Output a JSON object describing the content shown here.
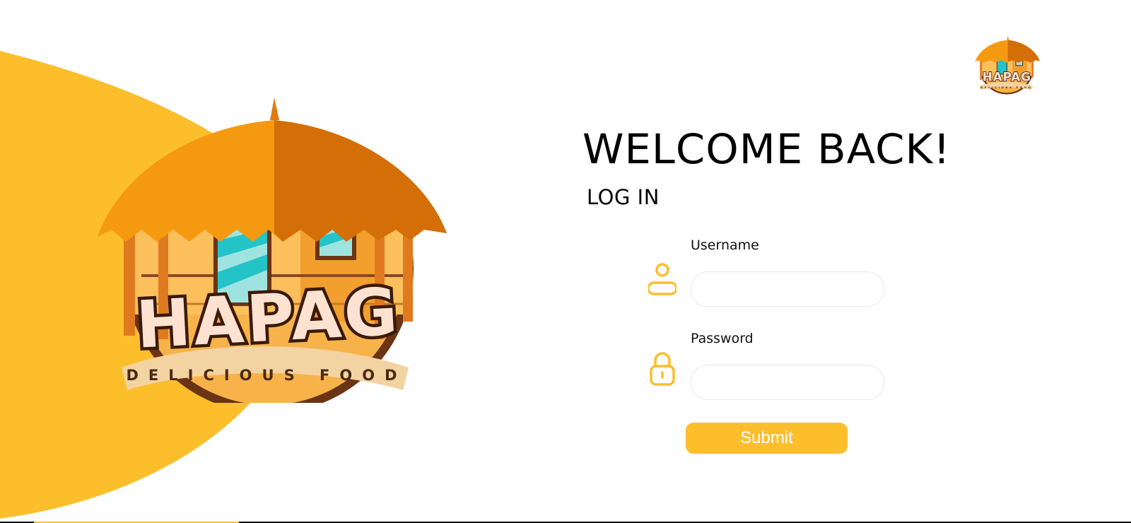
{
  "login": {
    "title": "WELCOME BACK!",
    "subtitle": "LOG IN",
    "username_label": "Username",
    "username_value": "",
    "password_label": "Password",
    "password_value": "",
    "submit_label": "Submit"
  },
  "brand": {
    "name": "HAPAG",
    "tagline": "DELICIOUS FOOD"
  },
  "colors": {
    "accent": "#fdbe2c",
    "icon": "#fdbe2c",
    "text": "#000000",
    "input_border": "#e8e8e8"
  },
  "icons": {
    "username": "user-icon",
    "password": "lock-icon"
  }
}
